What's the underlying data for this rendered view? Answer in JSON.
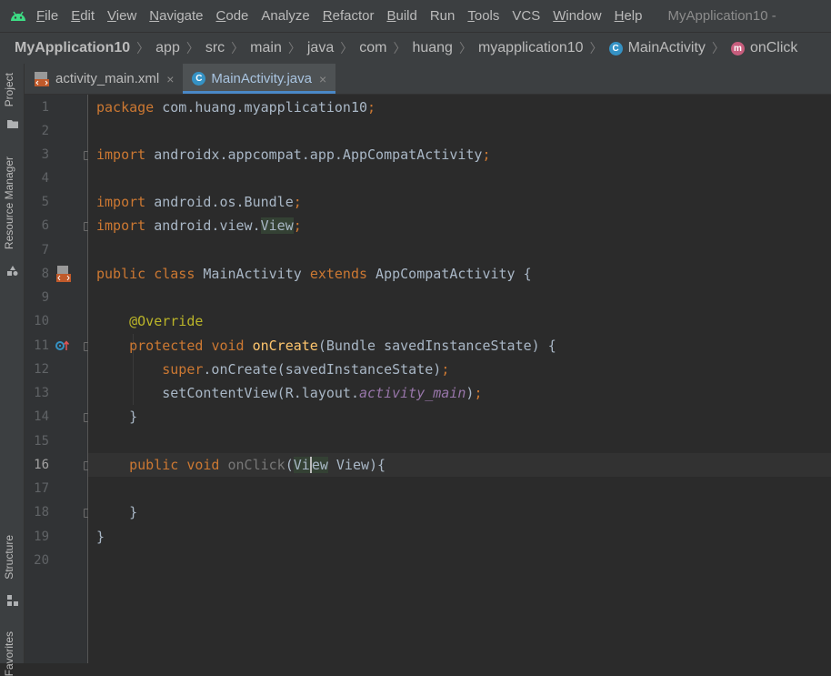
{
  "menu": {
    "items": [
      {
        "label": "File",
        "u": "F",
        "rest": "ile"
      },
      {
        "label": "Edit",
        "u": "E",
        "rest": "dit"
      },
      {
        "label": "View",
        "u": "V",
        "rest": "iew"
      },
      {
        "label": "Navigate",
        "u": "N",
        "rest": "avigate"
      },
      {
        "label": "Code",
        "u": "C",
        "rest": "ode"
      },
      {
        "label": "Analyze",
        "u": "",
        "rest": "Analyze"
      },
      {
        "label": "Refactor",
        "u": "R",
        "rest": "efactor"
      },
      {
        "label": "Build",
        "u": "B",
        "rest": "uild"
      },
      {
        "label": "Run",
        "u": "",
        "rest": "Run"
      },
      {
        "label": "Tools",
        "u": "T",
        "rest": "ools"
      },
      {
        "label": "VCS",
        "u": "",
        "rest": "VCS"
      },
      {
        "label": "Window",
        "u": "W",
        "rest": "indow"
      },
      {
        "label": "Help",
        "u": "H",
        "rest": "elp"
      }
    ],
    "window_title": "MyApplication10 -"
  },
  "breadcrumb": [
    "MyApplication10",
    "app",
    "src",
    "main",
    "java",
    "com",
    "huang",
    "myapplication10",
    "MainActivity",
    "onClick"
  ],
  "tool_windows": {
    "project": "Project",
    "resource_manager": "Resource Manager",
    "structure": "Structure",
    "favorites": "Favorites"
  },
  "tabs": [
    {
      "label": "activity_main.xml",
      "close": "×",
      "active": false
    },
    {
      "label": "MainActivity.java",
      "close": "×",
      "active": true
    }
  ],
  "editor": {
    "current_line": 16,
    "line_numbers": [
      "1",
      "2",
      "3",
      "4",
      "5",
      "6",
      "7",
      "8",
      "9",
      "10",
      "11",
      "12",
      "13",
      "14",
      "15",
      "16",
      "17",
      "18",
      "19",
      "20"
    ],
    "code": {
      "l1_kw": "package",
      "l1_rest": " com.huang.myapplication10",
      "l1_semi": ";",
      "l3_kw": "import",
      "l3_rest": " androidx.appcompat.app.AppCompatActivity",
      "l3_semi": ";",
      "l5_kw": "import",
      "l5_rest": " android.os.Bundle",
      "l5_semi": ";",
      "l6_kw": "import",
      "l6_rest": " android.view.",
      "l6_hl": "View",
      "l6_semi": ";",
      "l8_kw1": "public",
      "l8_kw2": "class",
      "l8_name": " MainActivity ",
      "l8_kw3": "extends",
      "l8_rest": " AppCompatActivity {",
      "l10_ann": "@Override",
      "l11_kw1": "protected",
      "l11_kw2": "void",
      "l11_fn": "onCreate",
      "l11_rest": "(Bundle savedInstanceState) {",
      "l12_kw": "super",
      "l12_rest": ".onCreate(savedInstanceState)",
      "l12_semi": ";",
      "l13_pre": "setContentView(R.layout.",
      "l13_fld": "activity_main",
      "l13_post": ")",
      "l13_semi": ";",
      "l14": "}",
      "l16_kw1": "public",
      "l16_kw2": "void",
      "l16_fn": "onClick",
      "l16_p1": "(",
      "l16_v1": "Vi",
      "l16_v2": "ew",
      "l16_rest": " View){",
      "l18": "}",
      "l19": "}"
    }
  },
  "colors": {
    "keyword": "#cc7832",
    "annotation": "#bbb529",
    "method": "#ffc66d",
    "field": "#9876aa",
    "text": "#a9b7c6",
    "background": "#2b2b2b"
  }
}
